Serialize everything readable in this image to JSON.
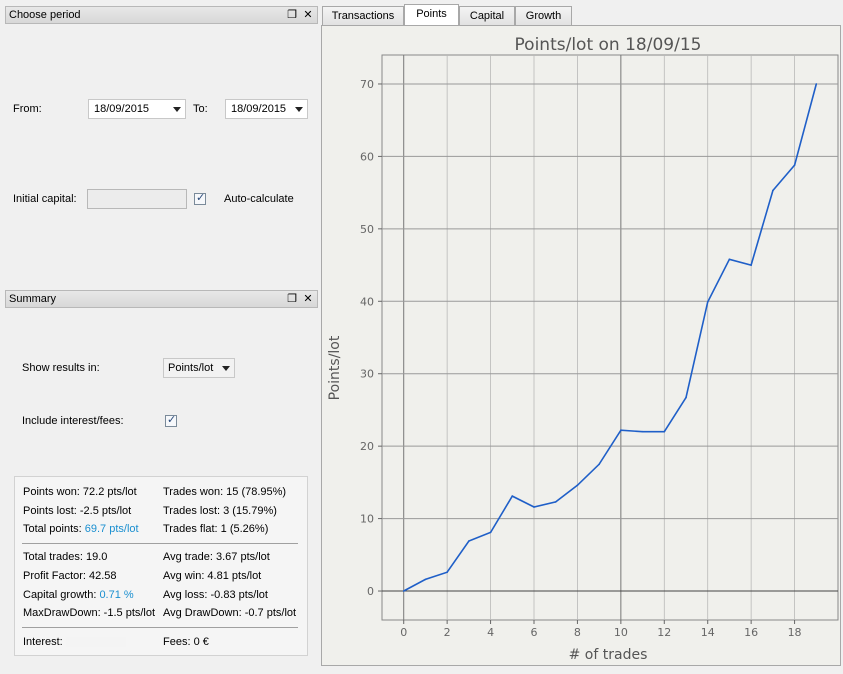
{
  "period_panel": {
    "title": "Choose period",
    "from_label": "From:",
    "from_value": "18/09/2015",
    "to_label": "To:",
    "to_value": "18/09/2015",
    "capital_label": "Initial capital:",
    "capital_value": "",
    "autocalc_label": "Auto-calculate",
    "autocalc_checked": true
  },
  "summary_panel": {
    "title": "Summary",
    "show_label": "Show results in:",
    "show_value": "Points/lot",
    "include_label": "Include interest/fees:",
    "include_checked": true,
    "stats": {
      "points_won": "Points won: 72.2 pts/lot",
      "trades_won": "Trades won: 15 (78.95%)",
      "points_lost": "Points lost: -2.5 pts/lot",
      "trades_lost": "Trades lost: 3 (15.79%)",
      "total_points_label": "Total points: ",
      "total_points_value": "69.7 pts/lot",
      "trades_flat": "Trades flat: 1 (5.26%)",
      "total_trades": "Total trades: 19.0",
      "avg_trade": "Avg trade: 3.67 pts/lot",
      "profit_factor": "Profit Factor: 42.58",
      "avg_win": "Avg win: 4.81 pts/lot",
      "capital_growth_label": "Capital growth: ",
      "capital_growth_value": "0.71 %",
      "avg_loss": "Avg loss: -0.83 pts/lot",
      "max_drawdown": "MaxDrawDown: -1.5 pts/lot",
      "avg_drawdown": "Avg DrawDown: -0.7 pts/lot",
      "interest_label": "Interest:",
      "fees": "Fees: 0 €"
    }
  },
  "tabs": [
    {
      "label": "Transactions",
      "active": false
    },
    {
      "label": "Points",
      "active": true
    },
    {
      "label": "Capital",
      "active": false
    },
    {
      "label": "Growth",
      "active": false
    }
  ],
  "colors": {
    "line": "#1f5fc8",
    "accent_text": "#1a8fd0"
  },
  "chart_data": {
    "type": "line",
    "title": "Points/lot on 18/09/15",
    "xlabel": "# of trades",
    "ylabel": "Points/lot",
    "x": [
      0,
      1,
      2,
      3,
      4,
      5,
      6,
      7,
      8,
      9,
      10,
      11,
      12,
      13,
      14,
      15,
      16,
      17,
      18,
      19
    ],
    "values": [
      0,
      1.6,
      2.6,
      6.9,
      8.1,
      13.1,
      11.6,
      12.3,
      14.6,
      17.5,
      22.2,
      22.0,
      22.0,
      26.7,
      39.9,
      45.8,
      45.0,
      55.3,
      58.8,
      70.0
    ],
    "xlim": [
      -1,
      20
    ],
    "ylim": [
      -4,
      74
    ],
    "xticks": [
      "0",
      "2",
      "4",
      "6",
      "8",
      "10",
      "12",
      "14",
      "16",
      "18"
    ],
    "yticks": [
      "0",
      "10",
      "20",
      "30",
      "40",
      "50",
      "60",
      "70"
    ],
    "grid": true
  }
}
